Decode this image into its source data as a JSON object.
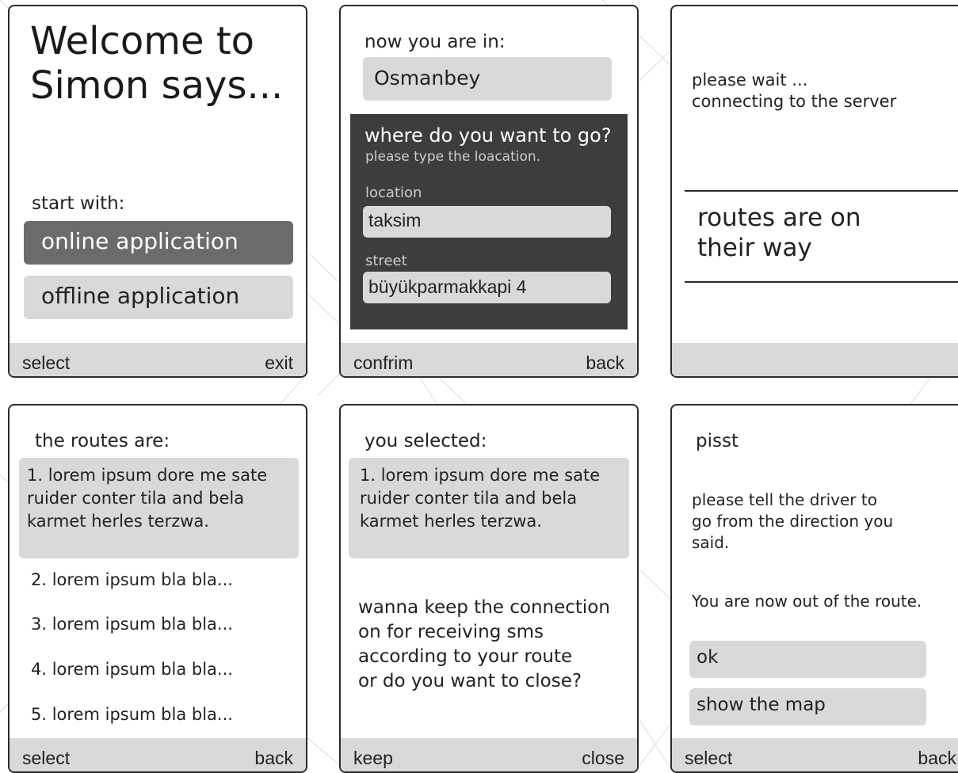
{
  "screens": {
    "welcome": {
      "title": "Welcome to\nSimon says...",
      "start_label": "start with:",
      "options": [
        "online application",
        "offline application"
      ],
      "softkeys": {
        "left": "select",
        "right": "exit"
      }
    },
    "location": {
      "now_label": "now you are in:",
      "current_location": "Osmanbey",
      "question": "where do you want to go?",
      "hint": "please type the loacation.",
      "location_label": "location",
      "location_value": "taksim",
      "street_label": "street",
      "street_value": "büyükparmakkapi 4",
      "softkeys": {
        "left": "confrim",
        "right": "back"
      }
    },
    "waiting": {
      "wait_text": "please wait ...\nconnecting to the server",
      "routes_text": "routes are on\ntheir way"
    },
    "routes": {
      "heading": "the routes are:",
      "items": [
        "1. lorem ipsum dore me sate\nruider conter tila and bela\nkarmet herles terzwa.",
        "2. lorem ipsum bla bla...",
        "3. lorem ipsum bla bla...",
        "4. lorem ipsum bla bla...",
        "5. lorem ipsum bla bla..."
      ],
      "softkeys": {
        "left": "select",
        "right": "back"
      }
    },
    "selected": {
      "heading": "you selected:",
      "selected_route": "1. lorem ipsum dore me sate\nruider conter tila and bela\nkarmet herles terzwa.",
      "question": "wanna keep the connection\non for receiving sms\naccording to your route\nor do you want to close?",
      "softkeys": {
        "left": "keep",
        "right": "close"
      }
    },
    "alert": {
      "title": "pisst",
      "message": "please tell the driver to\ngo from the direction you\nsaid.",
      "status": "You are now out of the route.",
      "buttons": [
        "ok",
        "show the map"
      ],
      "softkeys": {
        "left": "select",
        "right": "back"
      }
    }
  }
}
